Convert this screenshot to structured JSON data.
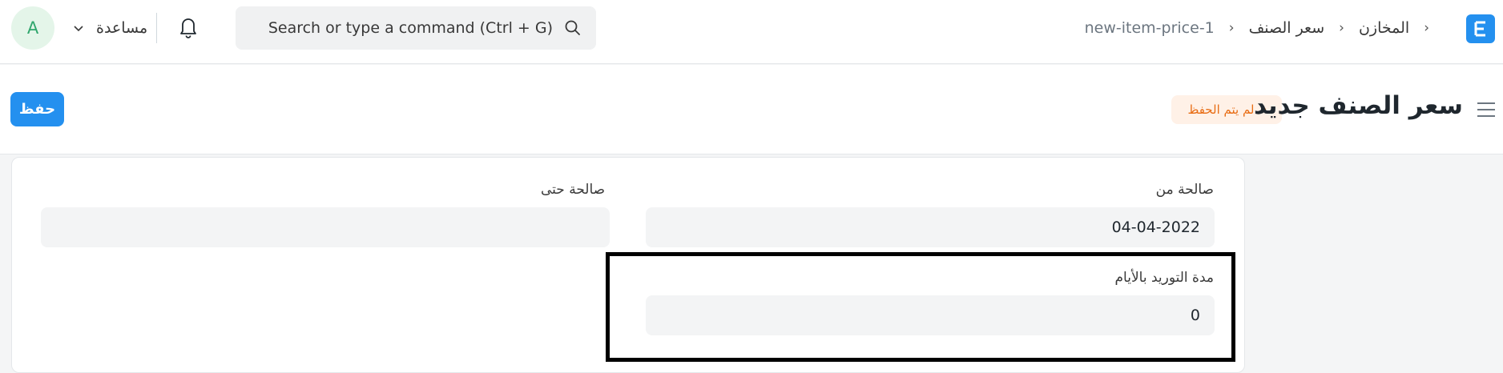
{
  "navbar": {
    "avatar_initial": "A",
    "help_label": "مساعدة",
    "search_placeholder": "Search or type a command (Ctrl + G)",
    "breadcrumb": [
      "المخازن",
      "سعر الصنف",
      "new-item-price-1"
    ],
    "logo_letter": "E"
  },
  "page": {
    "title": "سعر الصنف جديد",
    "status_badge": "لم يتم الحفظ",
    "save_label": "حفظ"
  },
  "form": {
    "valid_from": {
      "label": "صالحة من",
      "value": "04-04-2022"
    },
    "valid_upto": {
      "label": "صالحة حتى",
      "value": ""
    },
    "lead_time_days": {
      "label": "مدة التوريد بالأيام",
      "value": "0"
    }
  },
  "colors": {
    "primary": "#2490ef",
    "badge_text": "#e86c13",
    "badge_bg": "#fff1e7",
    "avatar_bg": "#e4f5e9",
    "avatar_text": "#30a66d"
  }
}
